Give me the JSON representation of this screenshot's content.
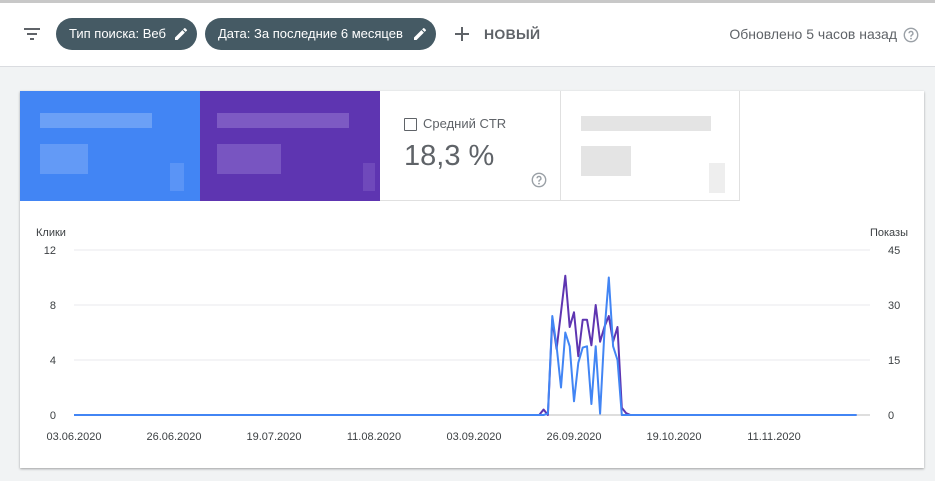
{
  "toolbar": {
    "chip_search_type": "Тип поиска: Веб",
    "chip_date": "Дата: За последние 6 месяцев",
    "new_label": "НОВЫЙ",
    "updated_text": "Обновлено 5 часов назад"
  },
  "metrics": {
    "ctr_label": "Средний CTR",
    "ctr_value": "18,3 %"
  },
  "colors": {
    "clicks": "#4285f4",
    "impressions": "#5e35b1",
    "chip_bg": "#455a64"
  },
  "icons": [
    "filter-icon",
    "pencil-icon",
    "plus-icon",
    "help-icon",
    "checkbox-icon"
  ],
  "chart_data": {
    "type": "line",
    "left_axis_label": "Клики",
    "right_axis_label": "Показы",
    "left_ticks": [
      "0",
      "4",
      "8",
      "12"
    ],
    "right_ticks": [
      "0",
      "15",
      "30",
      "45"
    ],
    "left_ylim": [
      0,
      12
    ],
    "right_ylim": [
      0,
      45
    ],
    "x_ticks": [
      "03.06.2020",
      "26.06.2020",
      "19.07.2020",
      "11.08.2020",
      "03.09.2020",
      "26.09.2020",
      "19.10.2020",
      "11.11.2020"
    ],
    "x_range": [
      "2020-06-03",
      "2020-11-30"
    ],
    "grid": true,
    "series": [
      {
        "name": "Клики",
        "axis": "left",
        "dates": [
          "2020-06-03",
          "2020-09-18",
          "2020-09-19",
          "2020-09-20",
          "2020-09-21",
          "2020-09-22",
          "2020-09-23",
          "2020-09-24",
          "2020-09-25",
          "2020-09-26",
          "2020-09-27",
          "2020-09-28",
          "2020-09-29",
          "2020-09-30",
          "2020-10-01",
          "2020-10-02",
          "2020-10-03",
          "2020-10-04",
          "2020-10-05",
          "2020-10-06",
          "2020-10-07",
          "2020-11-30"
        ],
        "values": [
          0,
          0,
          0,
          0.1,
          7.2,
          5.0,
          2.0,
          6.0,
          5.0,
          1.0,
          3.8,
          4.9,
          5.0,
          0.8,
          5.0,
          0.1,
          6.0,
          10.0,
          5.0,
          4.0,
          0,
          0
        ]
      },
      {
        "name": "Показы",
        "axis": "right",
        "dates": [
          "2020-06-03",
          "2020-09-18",
          "2020-09-19",
          "2020-09-20",
          "2020-09-21",
          "2020-09-22",
          "2020-09-23",
          "2020-09-24",
          "2020-09-25",
          "2020-09-26",
          "2020-09-27",
          "2020-09-28",
          "2020-09-29",
          "2020-09-30",
          "2020-10-01",
          "2020-10-02",
          "2020-10-03",
          "2020-10-04",
          "2020-10-05",
          "2020-10-06",
          "2020-10-07",
          "2020-10-08",
          "2020-10-09",
          "2020-11-30"
        ],
        "values": [
          0,
          0,
          1.5,
          0,
          26,
          18,
          28,
          38,
          24,
          28,
          16,
          26,
          26,
          19,
          30,
          20,
          24,
          27,
          20,
          24,
          2,
          0.5,
          0,
          0
        ]
      }
    ]
  }
}
